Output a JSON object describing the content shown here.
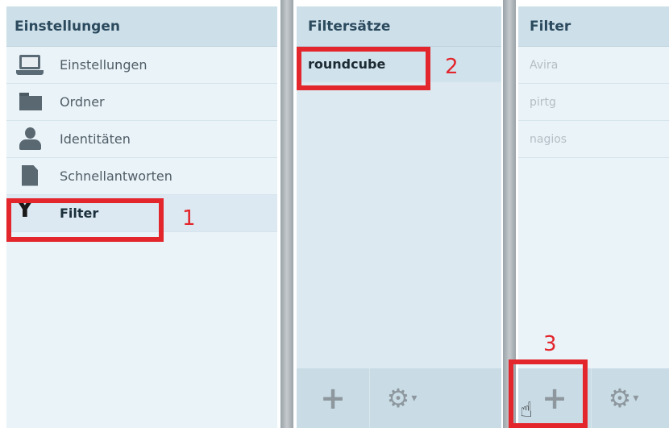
{
  "settings_panel": {
    "title": "Einstellungen",
    "items": [
      {
        "label": "Einstellungen",
        "icon": "laptop-icon"
      },
      {
        "label": "Ordner",
        "icon": "folder-icon"
      },
      {
        "label": "Identitäten",
        "icon": "person-icon"
      },
      {
        "label": "Schnellantworten",
        "icon": "document-icon"
      },
      {
        "label": "Filter",
        "icon": "filter-icon",
        "selected": true
      }
    ]
  },
  "filtersets_panel": {
    "title": "Filtersätze",
    "items": [
      {
        "label": "roundcube",
        "selected": true
      }
    ],
    "toolbar": {
      "add": "+",
      "gear": "⚙",
      "caret": "▾"
    }
  },
  "filters_panel": {
    "title": "Filter",
    "items": [
      {
        "label": "Avira"
      },
      {
        "label": "pirtg"
      },
      {
        "label": "nagios"
      }
    ],
    "toolbar": {
      "add": "+",
      "gear": "⚙",
      "caret": "▾"
    }
  },
  "annotations": {
    "one": "1",
    "two": "2",
    "three": "3"
  },
  "colors": {
    "annotation": "#e3252c",
    "header_bg": "#cde0ea"
  }
}
